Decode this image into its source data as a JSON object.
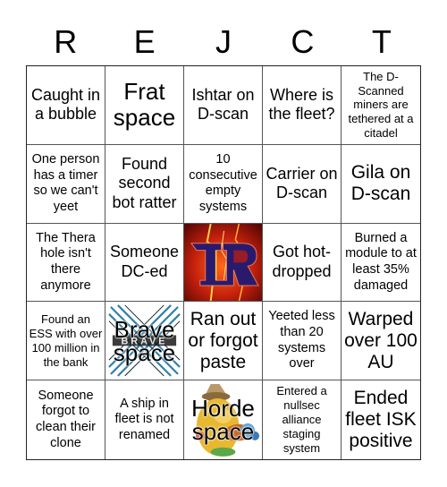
{
  "card": {
    "header_letters": [
      "R",
      "E",
      "J",
      "C",
      "T"
    ],
    "colors": {
      "grid_line": "#555555",
      "logo_background": "#c4200c",
      "logo_letter": "#2a1a6e",
      "lightning": "#ffd24a"
    },
    "cells": [
      {
        "text": "Caught in a bubble",
        "type": "text"
      },
      {
        "text": "Frat space",
        "type": "text"
      },
      {
        "text": "Ishtar on D-scan",
        "type": "text"
      },
      {
        "text": "Where is the fleet?",
        "type": "text"
      },
      {
        "text": "The D-Scanned miners are tethered at a citadel",
        "type": "text"
      },
      {
        "text": "One person has a timer so we can't yeet",
        "type": "text"
      },
      {
        "text": "Found second bot ratter",
        "type": "text"
      },
      {
        "text": "10 consecutive empty systems",
        "type": "text"
      },
      {
        "text": "Carrier on D-scan",
        "type": "text"
      },
      {
        "text": "Gila on D-scan",
        "type": "text"
      },
      {
        "text": "The Thera hole isn't there anymore",
        "type": "text"
      },
      {
        "text": "Someone DC-ed",
        "type": "text"
      },
      {
        "text": "",
        "type": "free-space-logo",
        "icon": "alliance-logo-lightning"
      },
      {
        "text": "Got hot-dropped",
        "type": "text"
      },
      {
        "text": "Burned a module to at least 35% damaged",
        "type": "text"
      },
      {
        "text": "Found an ESS with over 100 million in the bank",
        "type": "text"
      },
      {
        "text": "Brave space",
        "type": "image-text",
        "icon": "brave-logo",
        "logo_word": "BRAVE"
      },
      {
        "text": "Ran out or forgot paste",
        "type": "text"
      },
      {
        "text": "Yeeted less than 20 systems over",
        "type": "text"
      },
      {
        "text": "Warped over 100 AU",
        "type": "text"
      },
      {
        "text": "Someone forgot to clean their clone",
        "type": "text"
      },
      {
        "text": "A ship in fleet is not renamed",
        "type": "text"
      },
      {
        "text": "Horde space",
        "type": "image-text",
        "icon": "horde-mascot"
      },
      {
        "text": "Entered a nullsec alliance staging system",
        "type": "text"
      },
      {
        "text": "Ended fleet ISK positive",
        "type": "text"
      }
    ]
  }
}
